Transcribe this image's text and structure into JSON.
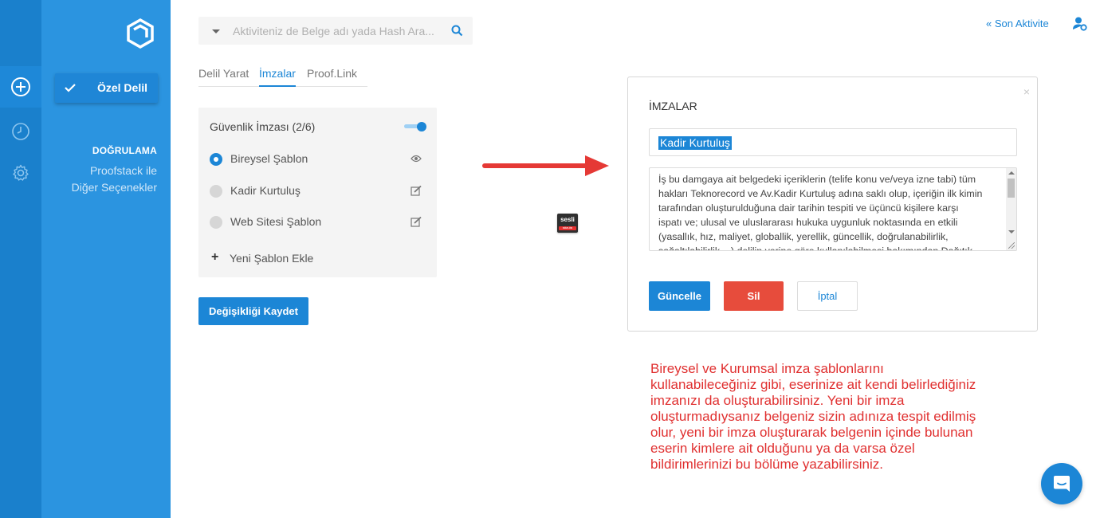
{
  "search": {
    "placeholder": "Aktiviteniz de Belge adı yada Hash Ara..."
  },
  "sidebar": {
    "selected_label": "Özel Delil",
    "section_title": "DOĞRULAMA",
    "link_line1": "Proofstack ile",
    "link_line2": "Diğer Seçenekler"
  },
  "tabs": [
    {
      "label": "Delil Yarat"
    },
    {
      "label": "İmzalar"
    },
    {
      "label": "Proof.Link"
    }
  ],
  "signature_card": {
    "title": "Güvenlik İmzası (2/6)",
    "items": [
      {
        "label": "Bireysel Şablon",
        "selected": true,
        "icon": "eye-icon"
      },
      {
        "label": "Kadir Kurtuluş",
        "selected": false,
        "icon": "edit-icon"
      },
      {
        "label": "Web Sitesi Şablon",
        "selected": false,
        "icon": "edit-icon"
      }
    ],
    "add_label": "Yeni Şablon Ekle"
  },
  "save_button": "Değişikliği Kaydet",
  "badge": {
    "line1": "sesli",
    "line2": "SÖZLÜK"
  },
  "modal": {
    "title": "İMZALAR",
    "close": "×",
    "name_value": "Kadir Kurtuluş",
    "text_lines": [
      "İş bu damgaya ait belgedeki içeriklerin (telife konu ve/veya izne tabi) tüm",
      "hakları Teknorecord ve Av.Kadir Kurtuluş adına saklı olup, içeriğin ilk kimin",
      "tarafından oluşturulduğuna dair tarihin tespiti ve üçüncü kişilere karşı",
      "ispatı ve; ulusal ve uluslararası hukuka uygunluk noktasında en etkili",
      "(yasallık, hız, maliyet, globallik, yerellik, güncellik, doğrulanabilirlik,",
      "sağaltılabilirlik,...) delilin yerine göre kullanılabilmesi bakımından Dağıtık"
    ],
    "update_label": "Güncelle",
    "delete_label": "Sil",
    "cancel_label": "İptal"
  },
  "annotation_lines": [
    "Bireysel ve Kurumsal imza şablonlarını",
    "kullanabileceğiniz gibi, eserinize ait kendi belirlediğiniz",
    "imzanızı da oluşturabilirsiniz. Yeni bir imza",
    "oluşturmadıysanız belgeniz sizin adınıza tespit edilmiş",
    "olur, yeni bir imza oluşturarak belgenin içinde bulunan",
    "eserin kimlere ait olduğunu ya da varsa özel",
    "bildirimlerinizi bu bölüme yazabilirsiniz."
  ],
  "header": {
    "recent_activity": "«  Son Aktivite"
  },
  "colors": {
    "primary": "#1c86d6",
    "panel": "#2b94e0",
    "danger": "#e74c3c",
    "annotation": "#e03030"
  }
}
